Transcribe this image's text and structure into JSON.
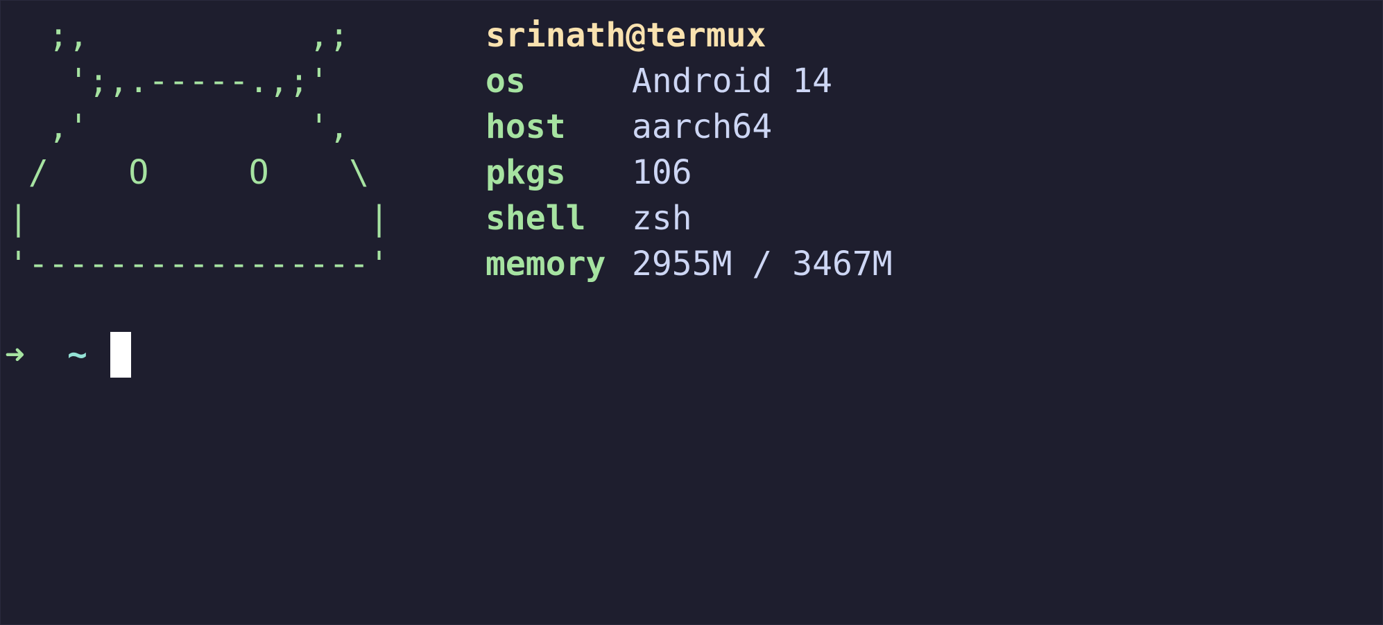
{
  "logo": {
    "ascii_art": "  ;,           ,;\n   ';,.-----.,;'\n  ,'           ',\n /    O     O    \\\n|                 |\n'-----------------'"
  },
  "info": {
    "title": "srinath@termux",
    "rows": [
      {
        "key": "os",
        "value": "Android 14"
      },
      {
        "key": "host",
        "value": "aarch64"
      },
      {
        "key": "pkgs",
        "value": "106"
      },
      {
        "key": "shell",
        "value": "zsh"
      },
      {
        "key": "memory",
        "value": "2955M / 3467M"
      }
    ]
  },
  "prompt": {
    "arrow": "➜",
    "dir": "~"
  },
  "colors": {
    "background": "#1e1e2e",
    "green": "#a6e3a1",
    "yellow": "#f9e2af",
    "text": "#cdd6f4",
    "teal": "#94e2d5",
    "cursor": "#ffffff"
  }
}
